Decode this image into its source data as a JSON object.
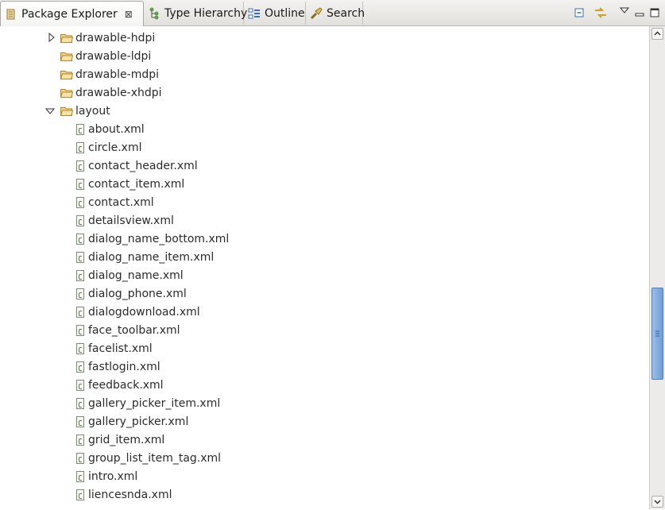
{
  "tabs": [
    {
      "label": "Package Explorer",
      "icon": "package-icon",
      "active": true,
      "close": "⊠"
    },
    {
      "label": "Type Hierarchy",
      "icon": "hierarchy-icon"
    },
    {
      "label": "Outline",
      "icon": "outline-icon"
    },
    {
      "label": "Search",
      "icon": "flashlight-icon"
    }
  ],
  "toolbar": {
    "icons": [
      "collapse-all-icon",
      "link-with-editor-icon",
      "view-menu-icon",
      "minimize-icon",
      "maximize-icon"
    ]
  },
  "tree": {
    "folders": [
      {
        "label": "drawable-hdpi",
        "expanded": false,
        "has_twisty": true
      },
      {
        "label": "drawable-ldpi"
      },
      {
        "label": "drawable-mdpi"
      },
      {
        "label": "drawable-xhdpi"
      },
      {
        "label": "layout",
        "expanded": true,
        "has_twisty": true
      }
    ],
    "files": [
      "about.xml",
      "circle.xml",
      "contact_header.xml",
      "contact_item.xml",
      "contact.xml",
      "detailsview.xml",
      "dialog_name_bottom.xml",
      "dialog_name_item.xml",
      "dialog_name.xml",
      "dialog_phone.xml",
      "dialogdownload.xml",
      "face_toolbar.xml",
      "facelist.xml",
      "fastlogin.xml",
      "feedback.xml",
      "gallery_picker_item.xml",
      "gallery_picker.xml",
      "grid_item.xml",
      "group_list_item_tag.xml",
      "intro.xml",
      "liencesnda.xml"
    ]
  },
  "scrollbar": {
    "position_fraction": 0.55
  }
}
